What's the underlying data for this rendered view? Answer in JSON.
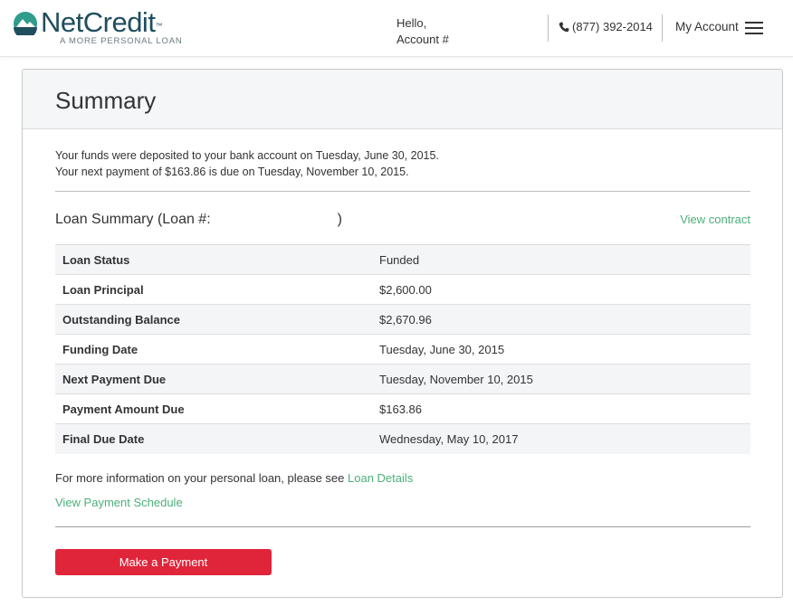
{
  "header": {
    "logo_text": "NetCredit",
    "logo_trademark": "™",
    "logo_tagline": "A MORE PERSONAL LOAN",
    "greeting_line1": "Hello,",
    "greeting_line2": "Account #",
    "phone": "(877) 392-2014",
    "account_label": "My Account"
  },
  "summary": {
    "title": "Summary",
    "message_line1": "Your funds were deposited to your bank account on Tuesday, June 30, 2015.",
    "message_line2": "Your next payment of $163.86 is due on Tuesday, November 10, 2015.",
    "loan_title_prefix": "Loan Summary (Loan #:",
    "loan_title_suffix": ")",
    "view_contract": "View contract",
    "rows": [
      {
        "label": "Loan Status",
        "value": "Funded"
      },
      {
        "label": "Loan Principal",
        "value": "$2,600.00"
      },
      {
        "label": "Outstanding Balance",
        "value": "$2,670.96"
      },
      {
        "label": "Funding Date",
        "value": "Tuesday, June 30, 2015"
      },
      {
        "label": "Next Payment Due",
        "value": "Tuesday, November 10, 2015"
      },
      {
        "label": "Payment Amount Due",
        "value": "$163.86"
      },
      {
        "label": "Final Due Date",
        "value": "Wednesday, May 10, 2017"
      }
    ],
    "more_info_text": "For more information on your personal loan, please see ",
    "loan_details_link": "Loan Details",
    "view_schedule_link": "View Payment Schedule",
    "make_payment_button": "Make a Payment"
  },
  "colors": {
    "brand_teal": "#1f4e5f",
    "link_green": "#4caf7a",
    "button_red": "#e0253a"
  }
}
